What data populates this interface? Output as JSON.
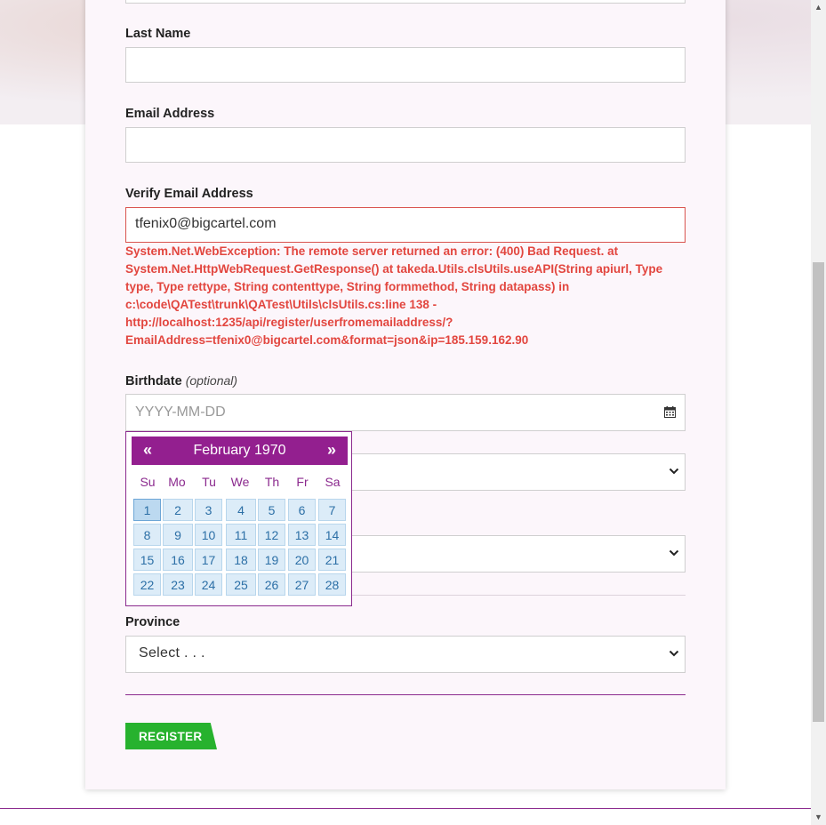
{
  "form": {
    "last_name_label": "Last Name",
    "last_name_value": "",
    "email_label": "Email Address",
    "email_value": "",
    "verify_email_label": "Verify Email Address",
    "verify_email_value": "tfenix0@bigcartel.com",
    "error_message": "System.Net.WebException: The remote server returned an error: (400) Bad Request. at System.Net.HttpWebRequest.GetResponse() at takeda.Utils.clsUtils.useAPI(String apiurl, Type type, Type rettype, String contenttype, String formmethod, String datapass) in c:\\code\\QATest\\trunk\\QATest\\Utils\\clsUtils.cs:line 138 - http://localhost:1235/api/register/userfromemailaddress/?EmailAddress=tfenix0@bigcartel.com&format=json&ip=185.159.162.90",
    "birthdate_label": "Birthdate",
    "birthdate_optional": "(optional)",
    "birthdate_placeholder": "YYYY-MM-DD",
    "province_label": "Province",
    "province_selected": "Select . . .",
    "register_label": "REGISTER"
  },
  "datepicker": {
    "prev": "«",
    "next": "»",
    "title": "February 1970",
    "weekdays": [
      "Su",
      "Mo",
      "Tu",
      "We",
      "Th",
      "Fr",
      "Sa"
    ],
    "weeks": [
      [
        "1",
        "2",
        "3",
        "4",
        "5",
        "6",
        "7"
      ],
      [
        "8",
        "9",
        "10",
        "11",
        "12",
        "13",
        "14"
      ],
      [
        "15",
        "16",
        "17",
        "18",
        "19",
        "20",
        "21"
      ],
      [
        "22",
        "23",
        "24",
        "25",
        "26",
        "27",
        "28"
      ]
    ],
    "active_day": "1"
  },
  "colors": {
    "accent": "#931f8f",
    "error": "#e2463f",
    "button": "#27b22e"
  }
}
